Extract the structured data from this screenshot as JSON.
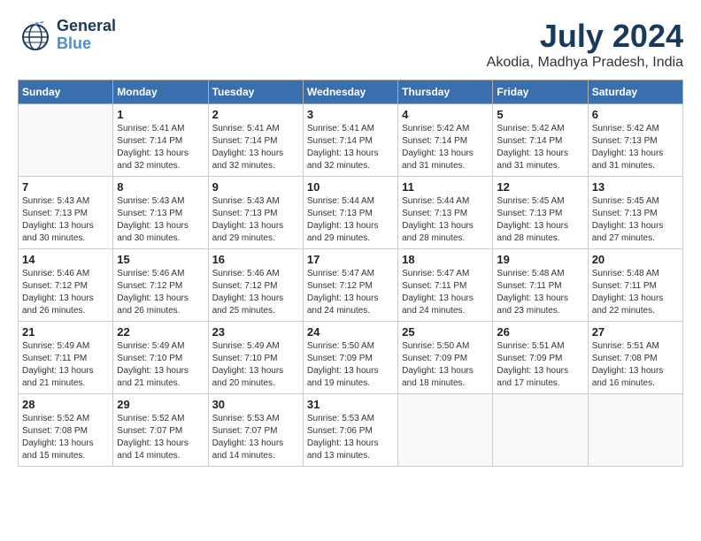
{
  "header": {
    "logo_line1": "General",
    "logo_line2": "Blue",
    "main_title": "July 2024",
    "subtitle": "Akodia, Madhya Pradesh, India"
  },
  "weekdays": [
    "Sunday",
    "Monday",
    "Tuesday",
    "Wednesday",
    "Thursday",
    "Friday",
    "Saturday"
  ],
  "weeks": [
    [
      {
        "day": "",
        "sunrise": "",
        "sunset": "",
        "daylight": ""
      },
      {
        "day": "1",
        "sunrise": "Sunrise: 5:41 AM",
        "sunset": "Sunset: 7:14 PM",
        "daylight": "Daylight: 13 hours and 32 minutes."
      },
      {
        "day": "2",
        "sunrise": "Sunrise: 5:41 AM",
        "sunset": "Sunset: 7:14 PM",
        "daylight": "Daylight: 13 hours and 32 minutes."
      },
      {
        "day": "3",
        "sunrise": "Sunrise: 5:41 AM",
        "sunset": "Sunset: 7:14 PM",
        "daylight": "Daylight: 13 hours and 32 minutes."
      },
      {
        "day": "4",
        "sunrise": "Sunrise: 5:42 AM",
        "sunset": "Sunset: 7:14 PM",
        "daylight": "Daylight: 13 hours and 31 minutes."
      },
      {
        "day": "5",
        "sunrise": "Sunrise: 5:42 AM",
        "sunset": "Sunset: 7:14 PM",
        "daylight": "Daylight: 13 hours and 31 minutes."
      },
      {
        "day": "6",
        "sunrise": "Sunrise: 5:42 AM",
        "sunset": "Sunset: 7:13 PM",
        "daylight": "Daylight: 13 hours and 31 minutes."
      }
    ],
    [
      {
        "day": "7",
        "sunrise": "Sunrise: 5:43 AM",
        "sunset": "Sunset: 7:13 PM",
        "daylight": "Daylight: 13 hours and 30 minutes."
      },
      {
        "day": "8",
        "sunrise": "Sunrise: 5:43 AM",
        "sunset": "Sunset: 7:13 PM",
        "daylight": "Daylight: 13 hours and 30 minutes."
      },
      {
        "day": "9",
        "sunrise": "Sunrise: 5:43 AM",
        "sunset": "Sunset: 7:13 PM",
        "daylight": "Daylight: 13 hours and 29 minutes."
      },
      {
        "day": "10",
        "sunrise": "Sunrise: 5:44 AM",
        "sunset": "Sunset: 7:13 PM",
        "daylight": "Daylight: 13 hours and 29 minutes."
      },
      {
        "day": "11",
        "sunrise": "Sunrise: 5:44 AM",
        "sunset": "Sunset: 7:13 PM",
        "daylight": "Daylight: 13 hours and 28 minutes."
      },
      {
        "day": "12",
        "sunrise": "Sunrise: 5:45 AM",
        "sunset": "Sunset: 7:13 PM",
        "daylight": "Daylight: 13 hours and 28 minutes."
      },
      {
        "day": "13",
        "sunrise": "Sunrise: 5:45 AM",
        "sunset": "Sunset: 7:13 PM",
        "daylight": "Daylight: 13 hours and 27 minutes."
      }
    ],
    [
      {
        "day": "14",
        "sunrise": "Sunrise: 5:46 AM",
        "sunset": "Sunset: 7:12 PM",
        "daylight": "Daylight: 13 hours and 26 minutes."
      },
      {
        "day": "15",
        "sunrise": "Sunrise: 5:46 AM",
        "sunset": "Sunset: 7:12 PM",
        "daylight": "Daylight: 13 hours and 26 minutes."
      },
      {
        "day": "16",
        "sunrise": "Sunrise: 5:46 AM",
        "sunset": "Sunset: 7:12 PM",
        "daylight": "Daylight: 13 hours and 25 minutes."
      },
      {
        "day": "17",
        "sunrise": "Sunrise: 5:47 AM",
        "sunset": "Sunset: 7:12 PM",
        "daylight": "Daylight: 13 hours and 24 minutes."
      },
      {
        "day": "18",
        "sunrise": "Sunrise: 5:47 AM",
        "sunset": "Sunset: 7:11 PM",
        "daylight": "Daylight: 13 hours and 24 minutes."
      },
      {
        "day": "19",
        "sunrise": "Sunrise: 5:48 AM",
        "sunset": "Sunset: 7:11 PM",
        "daylight": "Daylight: 13 hours and 23 minutes."
      },
      {
        "day": "20",
        "sunrise": "Sunrise: 5:48 AM",
        "sunset": "Sunset: 7:11 PM",
        "daylight": "Daylight: 13 hours and 22 minutes."
      }
    ],
    [
      {
        "day": "21",
        "sunrise": "Sunrise: 5:49 AM",
        "sunset": "Sunset: 7:11 PM",
        "daylight": "Daylight: 13 hours and 21 minutes."
      },
      {
        "day": "22",
        "sunrise": "Sunrise: 5:49 AM",
        "sunset": "Sunset: 7:10 PM",
        "daylight": "Daylight: 13 hours and 21 minutes."
      },
      {
        "day": "23",
        "sunrise": "Sunrise: 5:49 AM",
        "sunset": "Sunset: 7:10 PM",
        "daylight": "Daylight: 13 hours and 20 minutes."
      },
      {
        "day": "24",
        "sunrise": "Sunrise: 5:50 AM",
        "sunset": "Sunset: 7:09 PM",
        "daylight": "Daylight: 13 hours and 19 minutes."
      },
      {
        "day": "25",
        "sunrise": "Sunrise: 5:50 AM",
        "sunset": "Sunset: 7:09 PM",
        "daylight": "Daylight: 13 hours and 18 minutes."
      },
      {
        "day": "26",
        "sunrise": "Sunrise: 5:51 AM",
        "sunset": "Sunset: 7:09 PM",
        "daylight": "Daylight: 13 hours and 17 minutes."
      },
      {
        "day": "27",
        "sunrise": "Sunrise: 5:51 AM",
        "sunset": "Sunset: 7:08 PM",
        "daylight": "Daylight: 13 hours and 16 minutes."
      }
    ],
    [
      {
        "day": "28",
        "sunrise": "Sunrise: 5:52 AM",
        "sunset": "Sunset: 7:08 PM",
        "daylight": "Daylight: 13 hours and 15 minutes."
      },
      {
        "day": "29",
        "sunrise": "Sunrise: 5:52 AM",
        "sunset": "Sunset: 7:07 PM",
        "daylight": "Daylight: 13 hours and 14 minutes."
      },
      {
        "day": "30",
        "sunrise": "Sunrise: 5:53 AM",
        "sunset": "Sunset: 7:07 PM",
        "daylight": "Daylight: 13 hours and 14 minutes."
      },
      {
        "day": "31",
        "sunrise": "Sunrise: 5:53 AM",
        "sunset": "Sunset: 7:06 PM",
        "daylight": "Daylight: 13 hours and 13 minutes."
      },
      {
        "day": "",
        "sunrise": "",
        "sunset": "",
        "daylight": ""
      },
      {
        "day": "",
        "sunrise": "",
        "sunset": "",
        "daylight": ""
      },
      {
        "day": "",
        "sunrise": "",
        "sunset": "",
        "daylight": ""
      }
    ]
  ]
}
